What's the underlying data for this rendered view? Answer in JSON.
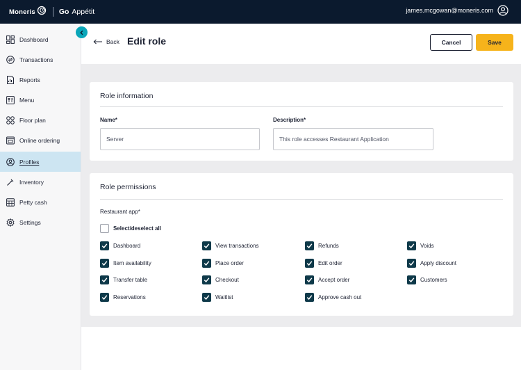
{
  "brand": {
    "name": "Moneris",
    "product_go": "Go",
    "product_app": "Appétit"
  },
  "user": {
    "email": "james.mcgowan@moneris.com"
  },
  "sidebar": {
    "items": [
      {
        "label": "Dashboard",
        "icon": "dashboard-icon"
      },
      {
        "label": "Transactions",
        "icon": "transactions-icon"
      },
      {
        "label": "Reports",
        "icon": "reports-icon"
      },
      {
        "label": "Menu",
        "icon": "menu-icon"
      },
      {
        "label": "Floor plan",
        "icon": "floor-plan-icon"
      },
      {
        "label": "Online ordering",
        "icon": "online-ordering-icon"
      },
      {
        "label": "Profiles",
        "icon": "profiles-icon",
        "active": true
      },
      {
        "label": "Inventory",
        "icon": "inventory-icon"
      },
      {
        "label": "Petty cash",
        "icon": "petty-cash-icon"
      },
      {
        "label": "Settings",
        "icon": "settings-icon"
      }
    ]
  },
  "header": {
    "back_label": "Back",
    "title": "Edit role",
    "cancel_label": "Cancel",
    "save_label": "Save"
  },
  "role_info": {
    "title": "Role information",
    "name_label": "Name*",
    "name_value": "Server",
    "description_label": "Description*",
    "description_value": "This role accesses Restaurant Application"
  },
  "permissions": {
    "title": "Role permissions",
    "section_label": "Restaurant app*",
    "select_all_label": "Select/deselect all",
    "select_all_checked": false,
    "items": [
      {
        "label": "Dashboard",
        "checked": true
      },
      {
        "label": "View transactions",
        "checked": true
      },
      {
        "label": "Refunds",
        "checked": true
      },
      {
        "label": "Voids",
        "checked": true
      },
      {
        "label": "Item availability",
        "checked": true
      },
      {
        "label": "Place order",
        "checked": true
      },
      {
        "label": "Edit order",
        "checked": true
      },
      {
        "label": "Apply discount",
        "checked": true
      },
      {
        "label": "Transfer table",
        "checked": true
      },
      {
        "label": "Checkout",
        "checked": true
      },
      {
        "label": "Accept order",
        "checked": true
      },
      {
        "label": "Customers",
        "checked": true
      },
      {
        "label": "Reservations",
        "checked": true
      },
      {
        "label": "Waitlist",
        "checked": true
      },
      {
        "label": "Approve cash out",
        "checked": true
      }
    ]
  },
  "colors": {
    "topbar": "#0b1a2e",
    "accent": "#0aa6b9",
    "save": "#f6b31b",
    "checkbox": "#0e3949",
    "active_nav": "#cde5f2"
  }
}
